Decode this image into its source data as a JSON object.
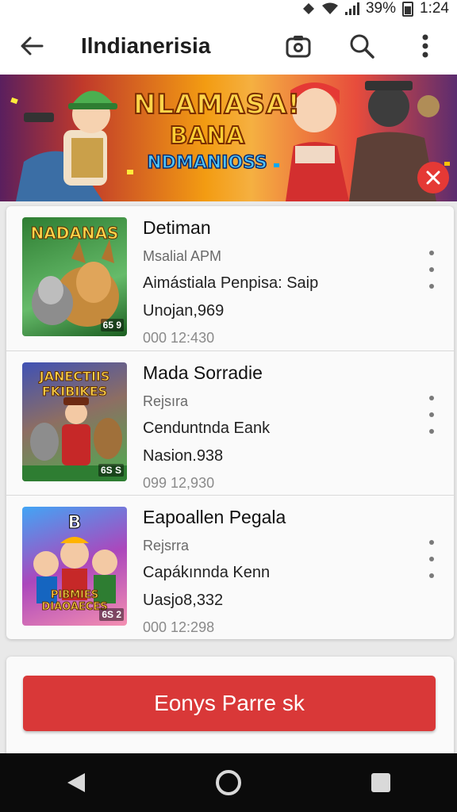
{
  "status": {
    "battery_pct": "39%",
    "time": "1:24"
  },
  "app_bar": {
    "title": "Ilndianerisia",
    "icons": [
      "back-arrow-icon",
      "camera-icon",
      "search-icon",
      "more-vert-icon"
    ]
  },
  "banner": {
    "line1": "NLAMASA!",
    "line2": "BANA",
    "line3": "NDMANIOSS",
    "close_icon": "close-icon",
    "colors": {
      "close": "#e53935"
    }
  },
  "items": [
    {
      "thumb_label": "NADANAS",
      "thumb_badge": "65 9",
      "title": "Detiman",
      "subtitle": "Msalial APM",
      "description": "Aimástiala Penpisa: Saip",
      "count": "Unojan,969",
      "time": "000 12:430"
    },
    {
      "thumb_label": "JANECTIIS FKIBIKES",
      "thumb_badge": "6S S",
      "title": "Mada Sorradie",
      "subtitle": "Rejsıra",
      "description": "Cenduntnda Eank",
      "count": "Nasion.938",
      "time": "099 12,930"
    },
    {
      "thumb_label": "B",
      "thumb_badge": "6S 2",
      "thumb_caption": "PIBMIES DIAOAECES",
      "title": "Eapoallen Pegala",
      "subtitle": "Rejsrra",
      "description": "Capákınnda Kenn",
      "count": "Uasjo8,332",
      "time": "000 12:298"
    }
  ],
  "cta": {
    "label": "Eonys Parre sk",
    "color": "#d93838"
  },
  "nav": {
    "icons": [
      "back-triangle-icon",
      "home-circle-icon",
      "recents-square-icon"
    ]
  }
}
